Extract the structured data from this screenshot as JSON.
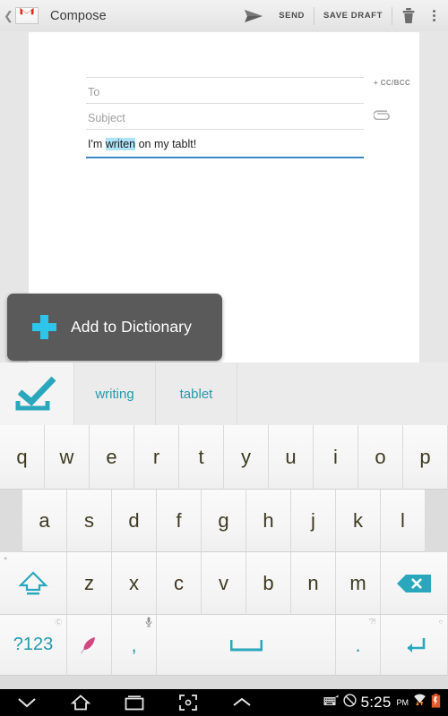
{
  "actionbar": {
    "back_icon": "back-chevron-icon",
    "logo": "gmail-logo",
    "title": "Compose",
    "send_icon": "send-arrow-icon",
    "send_label": "SEND",
    "save_draft_label": "SAVE DRAFT",
    "delete_icon": "trash-icon",
    "overflow_icon": "overflow-menu-icon"
  },
  "compose": {
    "from_value": "",
    "to_placeholder": "To",
    "subject_placeholder": "Subject",
    "body_prefix": "I'm ",
    "body_highlight": "writen",
    "body_suffix": " on my tablt!",
    "ccbcc_label": "+ CC/BCC",
    "attach_icon": "paperclip-icon",
    "focus_color": "#3b87c8",
    "highlight_color": "#ace3f7"
  },
  "dictionary_popup": {
    "label": "Add to Dictionary",
    "plus_icon": "plus-icon",
    "accent": "#2ec5ea",
    "background": "#5a5a5a"
  },
  "keyboard": {
    "accent": "#2699ab",
    "suggestions": {
      "check_icon": "checkmark-icon",
      "words": [
        "writing",
        "tablet"
      ]
    },
    "row1": [
      "q",
      "w",
      "e",
      "r",
      "t",
      "y",
      "u",
      "i",
      "o",
      "p"
    ],
    "row2": [
      "a",
      "s",
      "d",
      "f",
      "g",
      "h",
      "j",
      "k",
      "l"
    ],
    "row3": [
      "z",
      "x",
      "c",
      "v",
      "b",
      "n",
      "m"
    ],
    "shift_icon": "shift-icon",
    "backspace_icon": "backspace-icon",
    "symbols_label": "?123",
    "symbols_hint": "settings-hint",
    "quill_icon": "quill-icon",
    "comma_label": ",",
    "comma_hint_icon": "microphone-icon",
    "space_icon": "spacebar-icon",
    "period_label": ".",
    "period_hint": "'?!",
    "enter_icon": "enter-icon"
  },
  "navbar": {
    "hide_keyboard_icon": "chevron-down-icon",
    "home_icon": "home-icon",
    "recents_icon": "recent-apps-icon",
    "screenshot_icon": "screenshot-icon",
    "expand_icon": "chevron-up-icon",
    "keyboard_status_icon": "keyboard-status-icon",
    "mute_icon": "mute-icon",
    "time": "5:25",
    "ampm": "PM",
    "wifi_icon": "wifi-icon",
    "battery_icon": "battery-low-icon"
  }
}
